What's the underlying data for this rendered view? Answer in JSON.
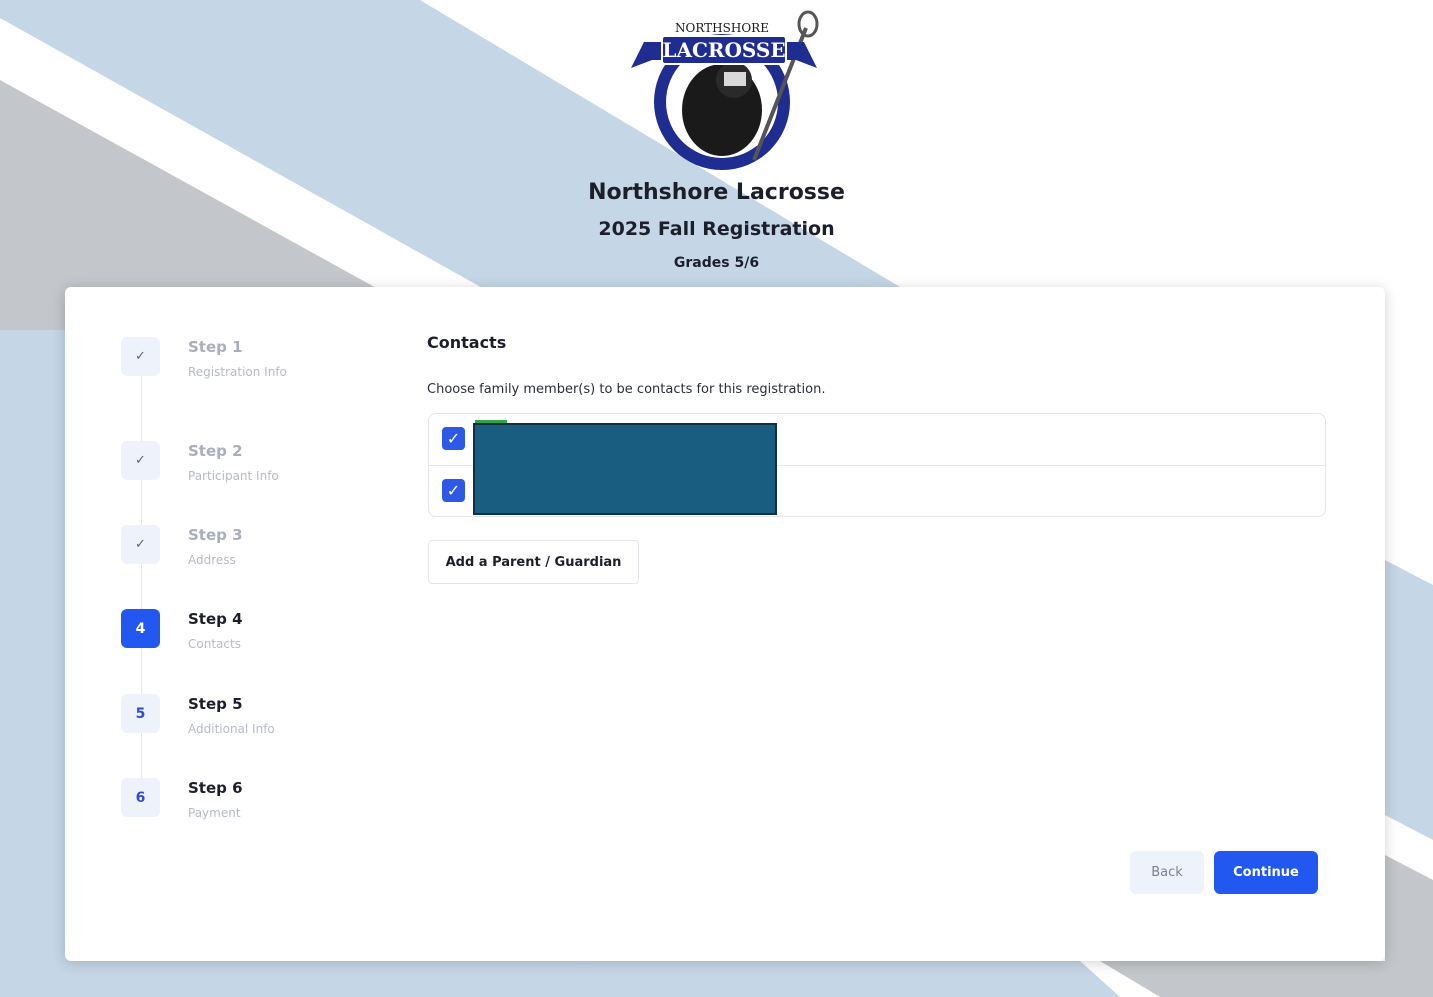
{
  "header": {
    "logo": {
      "top_text": "NORTHSHORE",
      "banner_text": "LACROSSE"
    },
    "org_name": "Northshore Lacrosse",
    "season": "2025 Fall Registration",
    "grades": "Grades 5/6"
  },
  "colors": {
    "accent": "#2358f0",
    "stripe_blue": "#c5d6e6",
    "stripe_gray": "#c3c6ca",
    "logo_navy": "#1e2d8f"
  },
  "steps": [
    {
      "number": "1",
      "title": "Step 1",
      "subtitle": "Registration Info",
      "status": "done",
      "icon": "check-icon"
    },
    {
      "number": "2",
      "title": "Step 2",
      "subtitle": "Participant Info",
      "status": "done",
      "icon": "check-icon"
    },
    {
      "number": "3",
      "title": "Step 3",
      "subtitle": "Address",
      "status": "done",
      "icon": "check-icon"
    },
    {
      "number": "4",
      "title": "Step 4",
      "subtitle": "Contacts",
      "status": "current"
    },
    {
      "number": "5",
      "title": "Step 5",
      "subtitle": "Additional Info",
      "status": "upcoming"
    },
    {
      "number": "6",
      "title": "Step 6",
      "subtitle": "Payment",
      "status": "upcoming"
    }
  ],
  "main": {
    "section_title": "Contacts",
    "description": "Choose family member(s) to be contacts for this registration.",
    "contacts": [
      {
        "checked": true
      },
      {
        "checked": true
      }
    ],
    "add_button": "Add a Parent / Guardian"
  },
  "footer": {
    "back_label": "Back",
    "continue_label": "Continue"
  }
}
